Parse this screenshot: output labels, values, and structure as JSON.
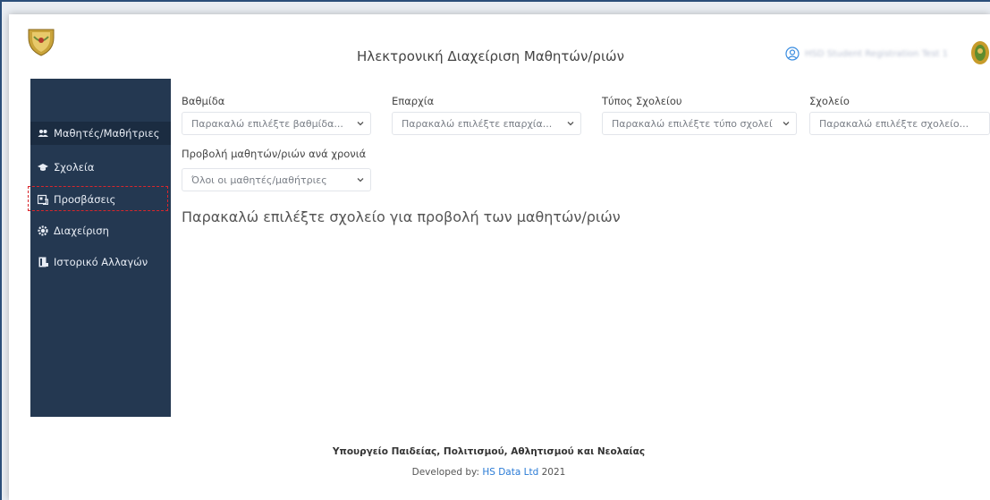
{
  "header": {
    "title": "Ηλεκτρονική Διαχείριση Μαθητών/ριών",
    "user_name": "HSD Student Registration Test 1"
  },
  "sidebar": {
    "items": [
      {
        "label": "Μαθητές/Μαθήτριες",
        "icon": "users-icon",
        "active": true
      },
      {
        "label": "Σχολεία",
        "icon": "graduation-cap-icon"
      },
      {
        "label": "Προσβάσεις",
        "icon": "access-card-icon",
        "highlighted": true
      },
      {
        "label": "Διαχείριση",
        "icon": "gear-icon"
      },
      {
        "label": "Ιστορικό Αλλαγών",
        "icon": "history-book-icon"
      }
    ]
  },
  "filters": {
    "level": {
      "label": "Βαθμίδα",
      "placeholder": "Παρακαλώ επιλέξτε βαθμίδα..."
    },
    "district": {
      "label": "Επαρχία",
      "placeholder": "Παρακαλώ επιλέξτε επαρχία..."
    },
    "school_type": {
      "label": "Τύπος Σχολείου",
      "placeholder": "Παρακαλώ επιλέξτε τύπο σχολεί"
    },
    "school": {
      "label": "Σχολείο",
      "placeholder": "Παρακαλώ επιλέξτε σχολείο..."
    },
    "year_view": {
      "label": "Προβολή μαθητών/ριών ανά χρονιά",
      "value": "Όλοι οι μαθητές/μαθήτριες"
    }
  },
  "main": {
    "prompt": "Παρακαλώ επιλέξτε σχολείο για προβολή των μαθητών/ριών"
  },
  "footer": {
    "organization": "Υπουργείο Παιδείας, Πολιτισμού, Αθλητισμού και Νεολαίας",
    "developed_by_prefix": "Developed by:",
    "developer": "HS Data Ltd",
    "year": "2021"
  },
  "colors": {
    "sidebar_bg": "#243851",
    "highlight": "#d9262c",
    "link": "#2a7bd6"
  }
}
